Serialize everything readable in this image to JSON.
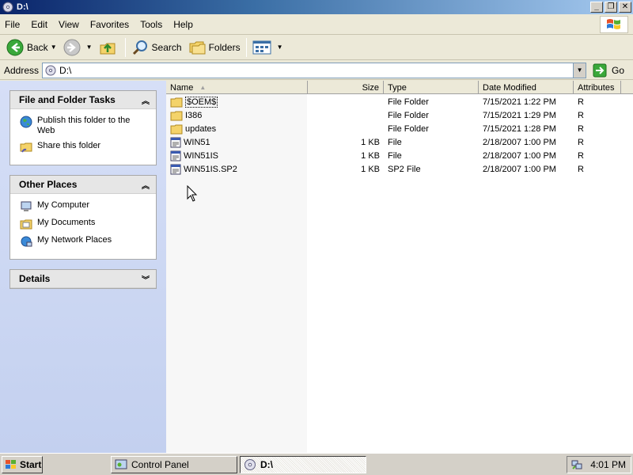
{
  "window": {
    "title": "D:\\"
  },
  "menu": [
    "File",
    "Edit",
    "View",
    "Favorites",
    "Tools",
    "Help"
  ],
  "toolbar": {
    "back": "Back",
    "search": "Search",
    "folders": "Folders"
  },
  "address": {
    "label": "Address",
    "value": "D:\\",
    "go": "Go"
  },
  "taskpane": {
    "file_tasks": {
      "title": "File and Folder Tasks",
      "items": [
        "Publish this folder to the Web",
        "Share this folder"
      ]
    },
    "other_places": {
      "title": "Other Places",
      "items": [
        "My Computer",
        "My Documents",
        "My Network Places"
      ]
    },
    "details": {
      "title": "Details"
    }
  },
  "columns": [
    "Name",
    "Size",
    "Type",
    "Date Modified",
    "Attributes"
  ],
  "files": [
    {
      "name": "$OEM$",
      "size": "",
      "type": "File Folder",
      "modified": "7/15/2021 1:22 PM",
      "attr": "R",
      "icon": "folder-icon"
    },
    {
      "name": "I386",
      "size": "",
      "type": "File Folder",
      "modified": "7/15/2021 1:29 PM",
      "attr": "R",
      "icon": "folder-icon"
    },
    {
      "name": "updates",
      "size": "",
      "type": "File Folder",
      "modified": "7/15/2021 1:28 PM",
      "attr": "R",
      "icon": "folder-icon"
    },
    {
      "name": "WIN51",
      "size": "1 KB",
      "type": "File",
      "modified": "2/18/2007 1:00 PM",
      "attr": "R",
      "icon": "file-icon"
    },
    {
      "name": "WIN51IS",
      "size": "1 KB",
      "type": "File",
      "modified": "2/18/2007 1:00 PM",
      "attr": "R",
      "icon": "file-icon"
    },
    {
      "name": "WIN51IS.SP2",
      "size": "1 KB",
      "type": "SP2 File",
      "modified": "2/18/2007 1:00 PM",
      "attr": "R",
      "icon": "file-icon"
    }
  ],
  "taskbar": {
    "start": "Start",
    "buttons": [
      "Control Panel",
      "D:\\"
    ],
    "clock": "4:01 PM"
  }
}
